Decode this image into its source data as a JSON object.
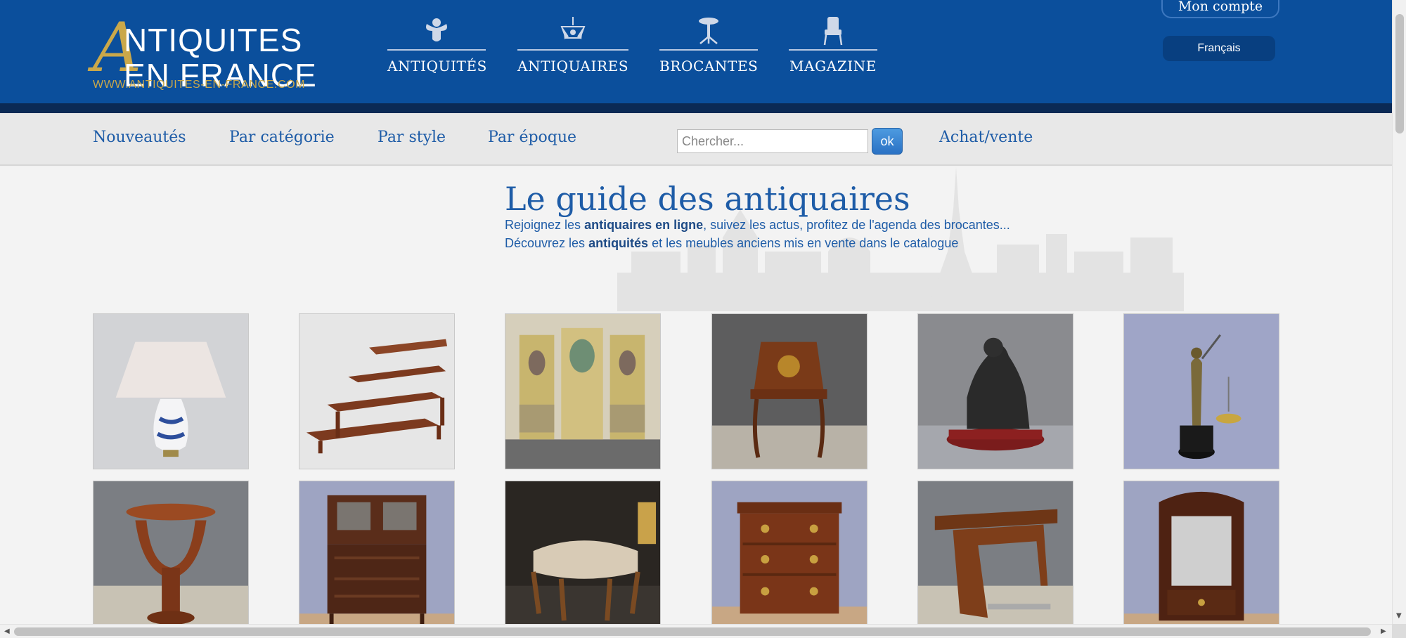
{
  "logo": {
    "line1": "NTIQUITES",
    "big_letter": "A",
    "line2": "EN FRANCE",
    "url": "WWW.ANTIQUITES-EN-FRANCE.COM"
  },
  "topnav": [
    {
      "label": "ANTIQUITÉS",
      "icon": "cherub-icon"
    },
    {
      "label": "ANTIQUAIRES",
      "icon": "chandelier-icon"
    },
    {
      "label": "BROCANTES",
      "icon": "gueridon-icon"
    },
    {
      "label": "MAGAZINE",
      "icon": "armchair-icon"
    }
  ],
  "account": {
    "label": "Mon compte"
  },
  "language": {
    "label": "Français"
  },
  "subnav": {
    "items": [
      "Nouveautés",
      "Par catégorie",
      "Par style",
      "Par époque"
    ],
    "search_placeholder": "Chercher...",
    "ok_label": "ok",
    "buy_sell": "Achat/vente"
  },
  "hero": {
    "title": "Le guide des antiquaires",
    "line1_a": "Rejoignez les ",
    "line1_b": "antiquaires en ligne",
    "line1_c": ", suivez les actus, profitez de l'agenda des brocantes...",
    "line2_a": "Découvrez les ",
    "line2_b": "antiquités",
    "line2_c": " et les meubles anciens mis en vente dans le catalogue"
  },
  "products": [
    {
      "name": "porcelain-lamp"
    },
    {
      "name": "library-steps"
    },
    {
      "name": "painted-panels"
    },
    {
      "name": "marquetry-writing-desk"
    },
    {
      "name": "bronze-sculpture"
    },
    {
      "name": "justice-statuette"
    },
    {
      "name": "art-deco-pedestal-table"
    },
    {
      "name": "dresser-buffet"
    },
    {
      "name": "footstool"
    },
    {
      "name": "chest-of-drawers"
    },
    {
      "name": "art-deco-side-table"
    },
    {
      "name": "mirror-cabinet"
    }
  ],
  "colors": {
    "header": "#0b4f9c",
    "header_band": "#0b2a55",
    "gold": "#caa84a",
    "link": "#1e5ca7"
  }
}
